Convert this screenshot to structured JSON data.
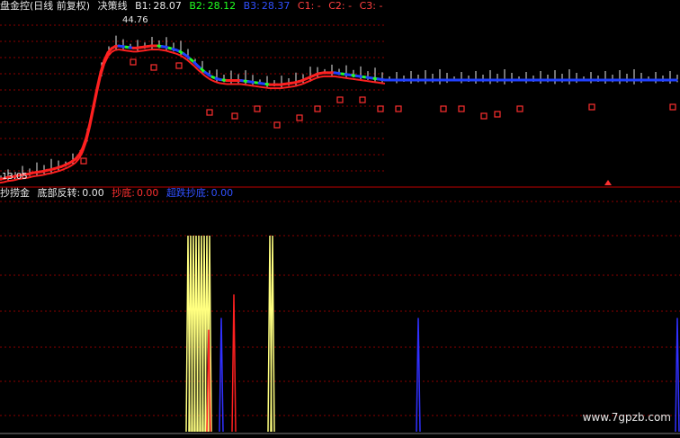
{
  "top_panel": {
    "title": "盘金控(日线 前复权)",
    "indicator": "决策线",
    "b1_label": "B1:",
    "b1_value": "28.07",
    "b2_label": "B2:",
    "b2_value": "28.12",
    "b3_label": "B3:",
    "b3_value": "28.37",
    "c1": "C1: -",
    "c2": "C2: -",
    "c3": "C3: -",
    "high_label": "44.76",
    "low_label": "13.05"
  },
  "bottom_panel": {
    "name": "抄捞金",
    "reversal_label": "底部反转:",
    "reversal_value": "0.00",
    "bottom_label": "抄底:",
    "bottom_value": "0.00",
    "ultra_label": "超跌抄底:",
    "ultra_value": "0.00"
  },
  "watermark": "www.7gpzb.com",
  "colors": {
    "background": "#000000",
    "grid": "#8b0000",
    "separator": "#c00000",
    "candle": "#e8e8e8",
    "line_red": "#ff2020",
    "line_blue": "#2040ff",
    "line_green": "#20ff20",
    "bar_yellow": "#ffff80",
    "spike_red": "#ff2020",
    "spike_blue": "#3030ff",
    "marker": "#ff3030",
    "title_white": "#e8e8e8",
    "b1": "#e8e8e8",
    "b2": "#20ff20",
    "b3": "#3050ff",
    "c_labels": "#ff4040",
    "reversal": "#e8e8e8",
    "bottom": "#ff3030",
    "ultra": "#3050ff"
  },
  "chart_data": [
    {
      "type": "line",
      "title": "决策线",
      "ylim": [
        13.05,
        44.76
      ],
      "x": [
        0,
        4,
        8,
        12,
        16,
        20,
        24,
        28,
        32,
        36,
        40,
        44,
        48,
        52,
        56,
        60,
        64,
        68,
        72,
        76,
        80,
        84,
        88,
        92,
        96,
        100,
        104,
        108,
        112,
        116,
        120,
        124,
        128,
        132,
        136,
        140,
        144,
        148,
        152,
        156,
        160,
        164,
        168,
        172,
        176,
        180,
        184,
        188,
        192,
        196,
        200,
        204,
        208,
        212,
        216,
        220,
        224,
        228,
        232,
        236,
        240,
        244,
        248,
        252,
        256,
        260,
        264,
        268,
        272,
        276,
        280,
        284,
        288,
        292,
        296,
        300,
        304,
        308,
        312,
        316,
        320,
        324,
        328,
        332,
        336,
        340,
        344,
        348,
        352,
        356,
        360,
        364,
        368,
        372,
        376,
        380,
        384,
        388,
        392,
        396,
        400,
        404,
        408,
        412,
        416,
        420,
        424,
        428,
        432,
        436,
        440,
        444,
        448,
        452,
        456,
        460,
        464,
        468,
        472,
        476,
        480,
        484,
        488,
        492,
        496,
        500,
        504,
        508,
        512,
        516,
        520,
        524,
        528,
        532,
        536,
        540,
        544,
        548,
        552,
        556,
        560,
        564,
        568,
        572,
        576,
        580,
        584,
        588,
        592,
        596,
        600,
        604,
        608,
        612,
        616,
        620,
        624,
        628,
        632,
        636,
        640,
        644,
        648,
        652,
        656,
        660,
        664,
        668,
        672,
        676,
        680,
        684,
        688,
        692,
        696,
        700,
        704,
        708,
        712,
        716,
        720,
        724,
        728,
        732,
        736,
        740,
        744,
        748,
        752
      ],
      "series": [
        {
          "values": [
            13.2,
            13.3,
            13.5,
            13.6,
            13.7,
            13.9,
            14.0,
            14.1,
            14.2,
            14.4,
            14.5,
            14.6,
            14.7,
            14.9,
            15.0,
            15.2,
            15.4,
            15.6,
            15.9,
            16.2,
            16.6,
            17.1,
            17.9,
            19.2,
            21.2,
            24.0,
            27.4,
            30.8,
            33.9,
            36.2,
            37.7,
            38.5,
            38.9,
            39.0,
            38.9,
            38.8,
            38.7,
            38.6,
            38.6,
            38.7,
            38.8,
            38.9,
            39.0,
            39.0,
            39.0,
            38.9,
            38.8,
            38.6,
            38.4,
            38.2,
            37.9,
            37.5,
            37.0,
            36.4,
            35.8,
            35.1,
            34.5,
            33.9,
            33.4,
            33.0,
            32.7,
            32.5,
            32.4,
            32.3,
            32.3,
            32.3,
            32.3,
            32.3,
            32.2,
            32.1,
            32.0,
            31.9,
            31.8,
            31.7,
            31.6,
            31.5,
            31.5,
            31.5,
            31.5,
            31.6,
            31.7,
            31.8,
            31.9,
            32.1,
            32.3,
            32.6,
            32.9,
            33.2,
            33.5,
            33.7,
            33.8,
            33.8,
            33.8,
            33.8,
            33.7,
            33.6,
            33.5,
            33.4,
            33.3,
            33.2,
            33.1,
            33.0,
            32.9,
            32.8,
            32.7,
            32.6,
            32.5,
            32.4,
            32.4,
            32.4,
            32.4,
            32.4,
            32.4,
            32.4,
            32.4,
            32.4,
            32.4,
            32.4,
            32.4,
            32.4,
            32.4,
            32.4,
            32.4,
            32.4,
            32.4,
            32.4,
            32.4,
            32.4,
            32.4,
            32.4,
            32.4,
            32.4,
            32.4,
            32.4,
            32.4,
            32.4,
            32.4,
            32.4,
            32.4,
            32.4,
            32.4,
            32.4,
            32.4,
            32.4,
            32.4,
            32.4,
            32.4,
            32.4,
            32.4,
            32.4,
            32.4,
            32.4,
            32.4,
            32.4,
            32.4,
            32.4,
            32.4,
            32.4,
            32.4,
            32.4,
            32.4,
            32.4,
            32.4,
            32.4,
            32.4,
            32.4,
            32.4,
            32.4,
            32.4,
            32.4,
            32.4,
            32.4,
            32.4,
            32.4,
            32.4,
            32.4,
            32.4,
            32.4,
            32.4,
            32.4,
            32.4,
            32.4,
            32.4,
            32.4,
            32.4,
            32.4,
            32.4,
            32.4,
            32.4
          ]
        }
      ]
    },
    {
      "type": "bar",
      "title": "抄捞金",
      "ylim": [
        0,
        100
      ],
      "series": [
        {
          "name": "底部反转",
          "x": [
            209,
            212,
            215,
            218,
            221,
            224,
            227,
            230,
            233,
            300,
            303
          ],
          "values": [
            100,
            100,
            100,
            100,
            100,
            100,
            100,
            100,
            100,
            100,
            100
          ]
        },
        {
          "name": "抄底",
          "x": [
            232,
            260
          ],
          "values": [
            52,
            70
          ]
        },
        {
          "name": "超跌抄底",
          "x": [
            246,
            465,
            753
          ],
          "values": [
            58,
            58,
            58
          ]
        }
      ]
    }
  ]
}
